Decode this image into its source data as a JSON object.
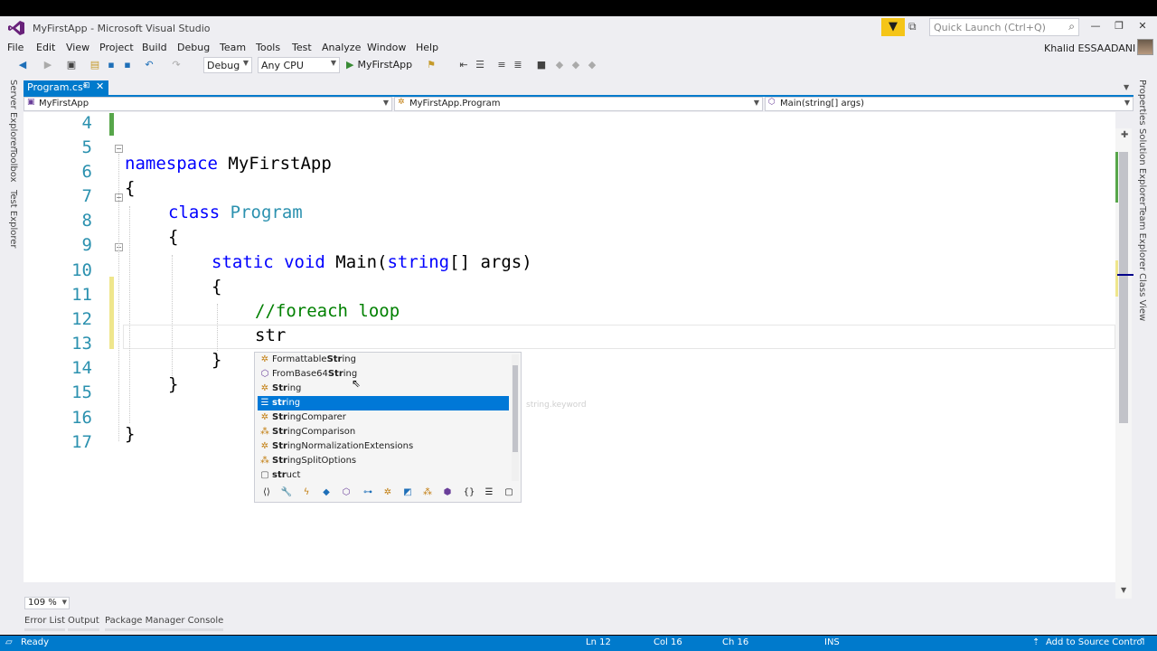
{
  "window": {
    "title": "MyFirstApp - Microsoft Visual Studio",
    "quick_launch_placeholder": "Quick Launch (Ctrl+Q)",
    "user_name": "Khalid ESSAADANI"
  },
  "menu": [
    "File",
    "Edit",
    "View",
    "Project",
    "Build",
    "Debug",
    "Team",
    "Tools",
    "Test",
    "Analyze",
    "Window",
    "Help"
  ],
  "toolbar": {
    "configuration": "Debug",
    "platform": "Any CPU",
    "run_target": "MyFirstApp"
  },
  "left_tool_tabs": [
    "Server Explorer",
    "Toolbox",
    "Test Explorer"
  ],
  "right_tool_tabs": [
    "Properties",
    "Solution Explorer",
    "Team Explorer",
    "Class View"
  ],
  "document_tab": {
    "label": "Program.cs*",
    "pin": "⊡",
    "close": "✕"
  },
  "navbar": {
    "project": "MyFirstApp",
    "type": "MyFirstApp.Program",
    "member": "Main(string[] args)"
  },
  "editor": {
    "line_numbers": [
      "4",
      "5",
      "6",
      "7",
      "8",
      "9",
      "10",
      "11",
      "12",
      "13",
      "14",
      "15",
      "16",
      "17"
    ],
    "code": {
      "l5_kw": "namespace",
      "l5_name": " MyFirstApp",
      "l6": "{",
      "l7_kw": "class",
      "l7_type": " Program",
      "l8": "{",
      "l9_kw1": "static",
      "l9_kw2": " void",
      "l9_rest1": " Main(",
      "l9_kw3": "string",
      "l9_rest2": "[] args)",
      "l10": "{",
      "l11_comment": "//foreach loop",
      "l12": "str",
      "l13": "}",
      "l14": "}",
      "l16": "}"
    },
    "zoom": "109 %"
  },
  "intellisense": {
    "items": [
      {
        "icon": "class-icon",
        "pre": "Formattable",
        "match": "Str",
        "post": "ing"
      },
      {
        "icon": "method-icon",
        "pre": "FromBase64",
        "match": "Str",
        "post": "ing"
      },
      {
        "icon": "class-icon",
        "pre": "",
        "match": "Str",
        "post": "ing"
      },
      {
        "icon": "keyword-icon",
        "pre": "",
        "match": "str",
        "post": "ing"
      },
      {
        "icon": "class-icon",
        "pre": "",
        "match": "Str",
        "post": "ingComparer"
      },
      {
        "icon": "enum-icon",
        "pre": "",
        "match": "Str",
        "post": "ingComparison"
      },
      {
        "icon": "class-icon",
        "pre": "",
        "match": "Str",
        "post": "ingNormalizationExtensions"
      },
      {
        "icon": "enum-icon",
        "pre": "",
        "match": "Str",
        "post": "ingSplitOptions"
      },
      {
        "icon": "snippet-icon",
        "pre": "",
        "match": "str",
        "post": "uct"
      }
    ],
    "selected_index": 3,
    "tooltip": "string.keyword"
  },
  "bottom_tabs": [
    "Error List",
    "Output",
    "Package Manager Console"
  ],
  "status": {
    "state": "Ready",
    "line": "Ln 12",
    "col": "Col 16",
    "ch": "Ch 16",
    "mode": "INS",
    "source_control": "Add to Source Control"
  },
  "colors": {
    "accent": "#007acc",
    "keyword": "#0000ff",
    "type": "#2b91af",
    "comment": "#008000",
    "selection": "#0078d7"
  }
}
